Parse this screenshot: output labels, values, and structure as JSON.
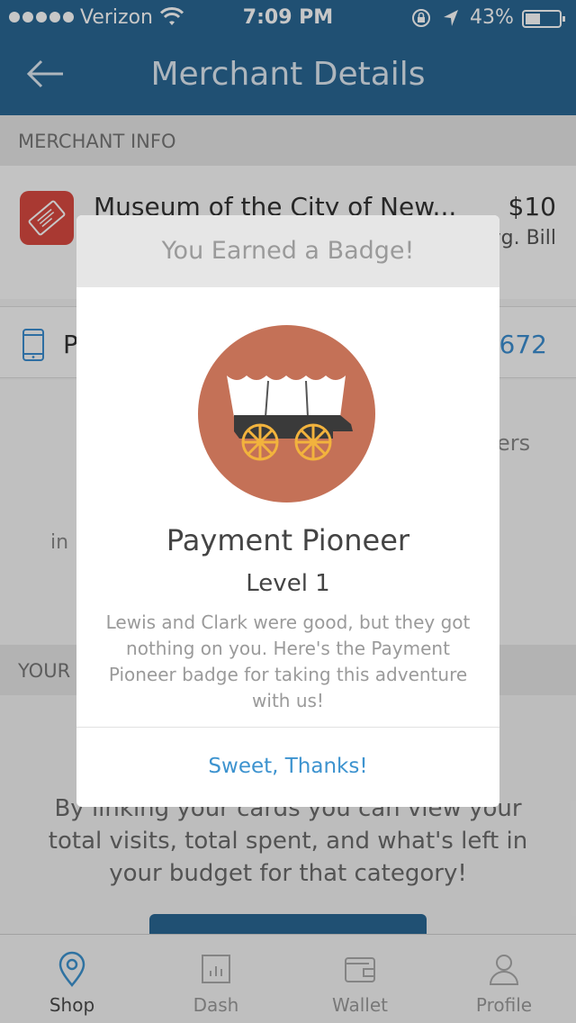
{
  "status_bar": {
    "carrier": "Verizon",
    "time": "7:09 PM",
    "battery": "43%"
  },
  "nav": {
    "title": "Merchant Details"
  },
  "merchant_info": {
    "section_label": "MERCHANT INFO",
    "name": "Museum of the City of New...",
    "price": "$10",
    "price_sub": "vg. Bill",
    "phone_prefix": "P",
    "phone_tail": "1672",
    "offers_fragment": "ers",
    "in_fragment": "in ."
  },
  "cards_section": {
    "label": "YOUR",
    "text": "By linking your cards you can view your total visits, total spent, and what's left in your budget for that category!"
  },
  "modal": {
    "header": "You Earned a Badge!",
    "badge_name": "Payment Pioneer",
    "level": "Level 1",
    "description": "Lewis and Clark were good, but they got nothing on you. Here's the Payment Pioneer badge for taking this adventure with us!",
    "button": "Sweet, Thanks!"
  },
  "tabs": [
    {
      "label": "Shop",
      "icon": "location-pin-icon",
      "active": true
    },
    {
      "label": "Dash",
      "icon": "bar-chart-icon",
      "active": false
    },
    {
      "label": "Wallet",
      "icon": "wallet-icon",
      "active": false
    },
    {
      "label": "Profile",
      "icon": "person-icon",
      "active": false
    }
  ],
  "colors": {
    "nav_bar": "#2a6794",
    "accent": "#3d93cf",
    "badge_circle": "#c47157",
    "wheel": "#f2b33d"
  }
}
